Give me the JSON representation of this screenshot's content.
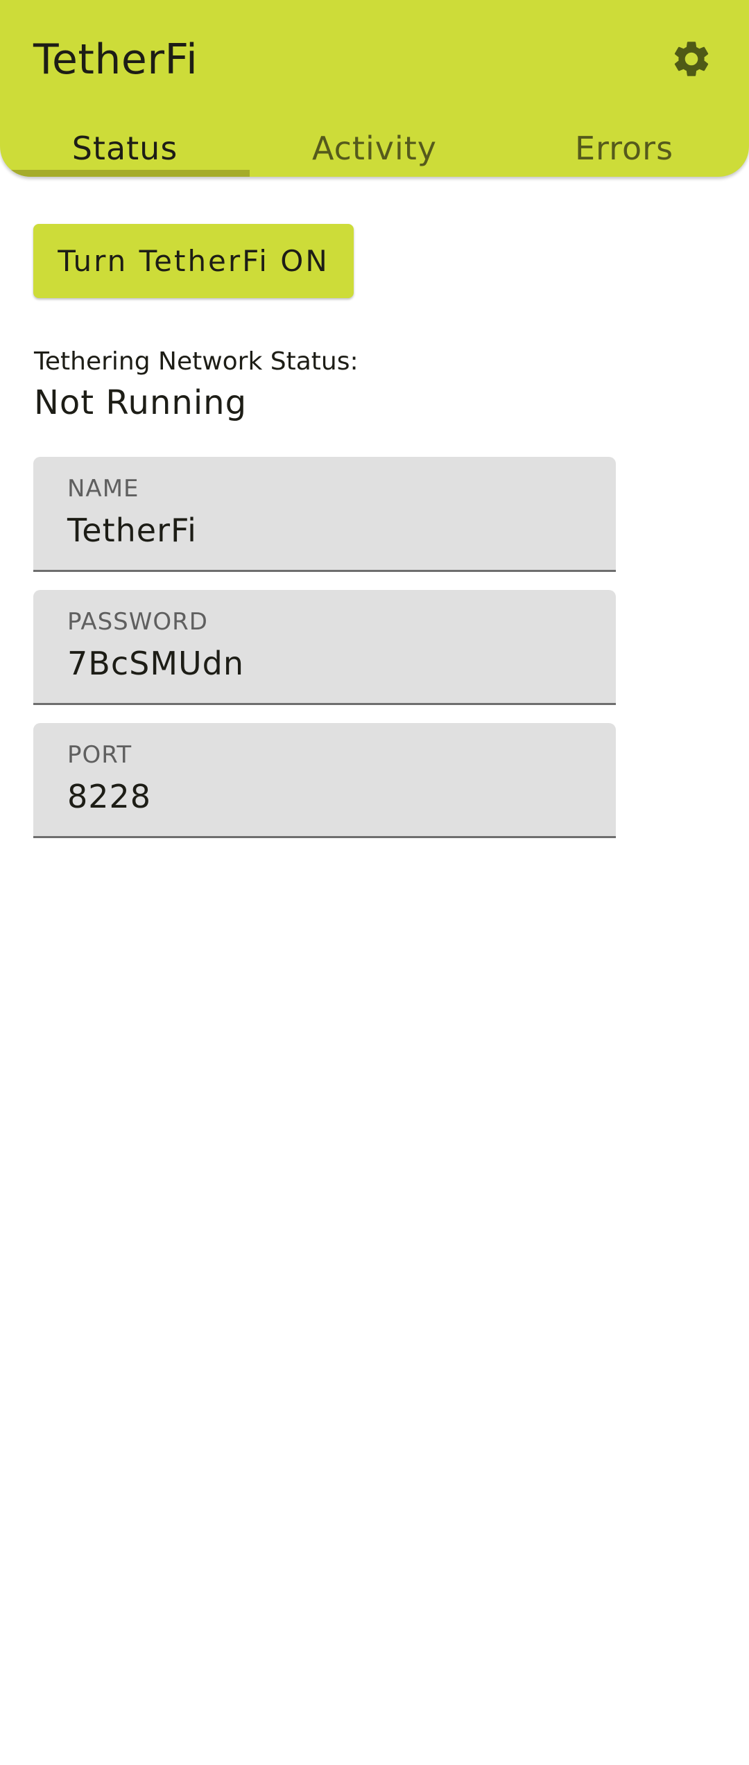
{
  "app": {
    "title": "TetherFi"
  },
  "header": {
    "settings_icon": "gear-icon",
    "tabs": [
      {
        "label": "Status",
        "active": true
      },
      {
        "label": "Activity",
        "active": false
      },
      {
        "label": "Errors",
        "active": false
      }
    ]
  },
  "status": {
    "toggle_button_label": "Turn TetherFi ON",
    "network_status_label": "Tethering Network Status:",
    "network_status_value": "Not Running"
  },
  "fields": {
    "name": {
      "label": "NAME",
      "value": "TetherFi"
    },
    "password": {
      "label": "PASSWORD",
      "value": "7BcSMUdn"
    },
    "port": {
      "label": "PORT",
      "value": "8228"
    }
  },
  "colors": {
    "accent": "#cddc39",
    "tab_indicator": "#a5ac2a",
    "settings_icon": "#4f5a16",
    "field_background": "#e0e0e0"
  }
}
